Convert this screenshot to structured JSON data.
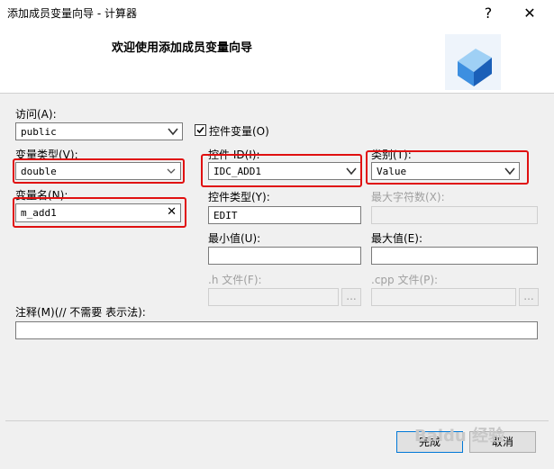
{
  "window": {
    "title": "添加成员变量向导 - 计算器",
    "help_glyph": "?",
    "close_glyph": "✕"
  },
  "header": {
    "welcome": "欢迎使用添加成员变量向导"
  },
  "access": {
    "label": "访问(A):",
    "value": "public"
  },
  "control_variable": {
    "label": "控件变量(O)",
    "checked": true
  },
  "var_type": {
    "label": "变量类型(V):",
    "value": "double"
  },
  "var_name": {
    "label": "变量名(N):",
    "value": "m_add1",
    "clear_glyph": "✕"
  },
  "control_id": {
    "label": "控件 ID(I):",
    "value": "IDC_ADD1"
  },
  "category": {
    "label": "类别(T):",
    "value": "Value"
  },
  "control_type": {
    "label": "控件类型(Y):",
    "value": "EDIT"
  },
  "max_chars": {
    "label": "最大字符数(X):",
    "value": ""
  },
  "min_value": {
    "label": "最小值(U):",
    "value": ""
  },
  "max_value": {
    "label": "最大值(E):",
    "value": ""
  },
  "h_file": {
    "label": ".h 文件(F):",
    "value": "",
    "browse_label": "..."
  },
  "cpp_file": {
    "label": ".cpp 文件(P):",
    "value": "",
    "browse_label": "..."
  },
  "comment": {
    "label": "注释(M)(// 不需要 表示法):",
    "value": ""
  },
  "footer": {
    "finish_label": "完成",
    "cancel_label": "取消"
  },
  "watermark": "Baidu 经验"
}
